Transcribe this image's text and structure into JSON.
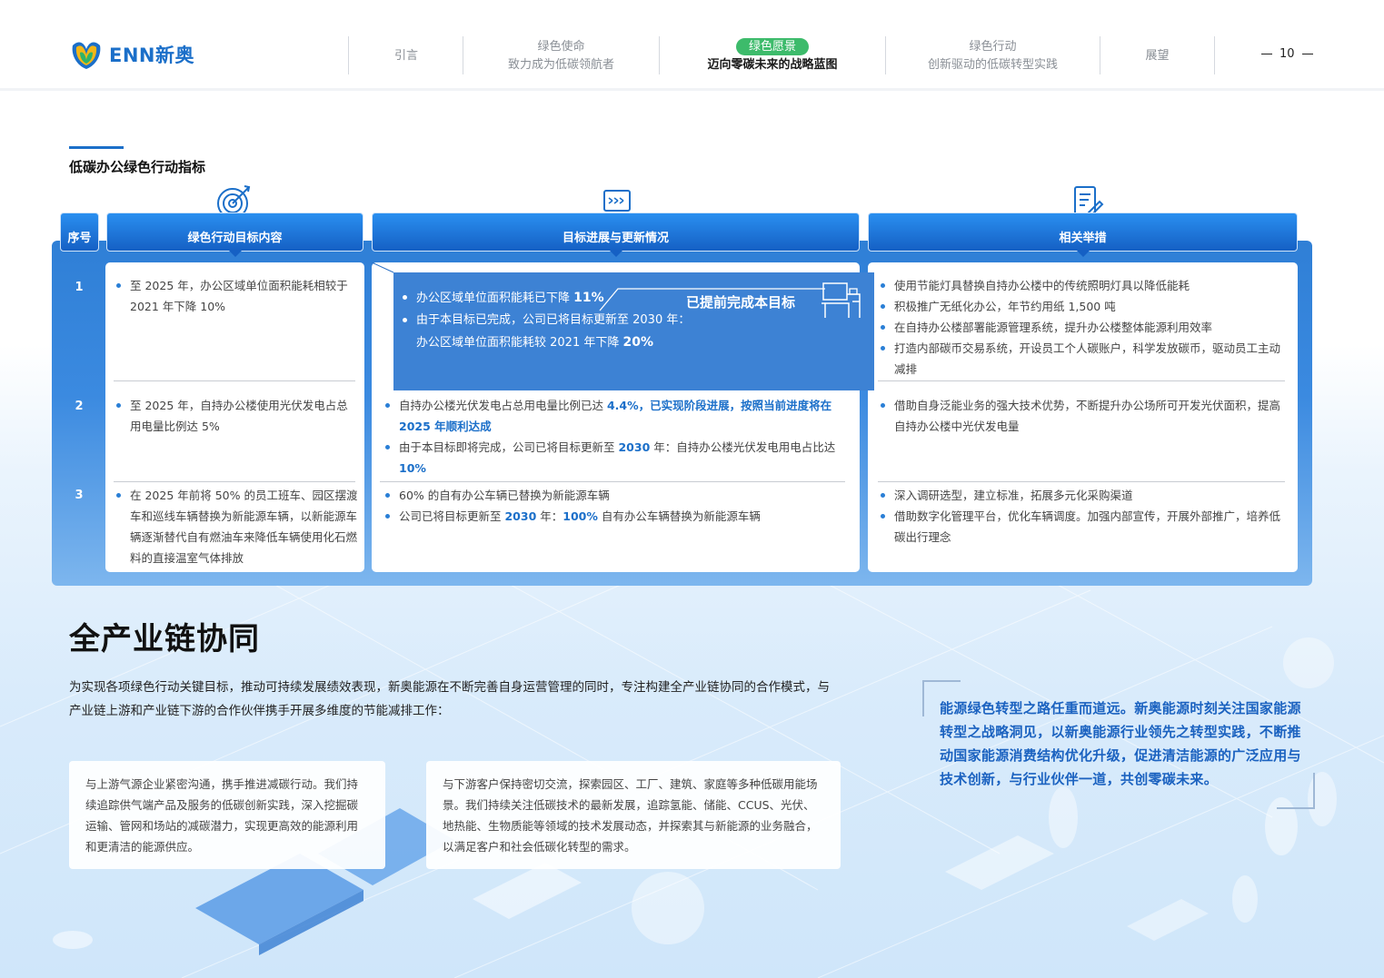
{
  "header": {
    "logo_text": "ENN新奥",
    "nav": [
      {
        "title": "引言",
        "sub": ""
      },
      {
        "title": "绿色使命",
        "sub": "致力成为低碳领航者"
      },
      {
        "title": "绿色愿景",
        "sub": "迈向零碳未来的战略蓝图",
        "active": true
      },
      {
        "title": "绿色行动",
        "sub": "创新驱动的低碳转型实践"
      },
      {
        "title": "展望",
        "sub": ""
      }
    ],
    "page_number": "10"
  },
  "section": {
    "title": "低碳办公绿色行动指标",
    "headers": {
      "seq": "序号",
      "target": "绿色行动目标内容",
      "progress": "目标进展与更新情况",
      "measures": "相关举措"
    },
    "rows": [
      {
        "seq": "1",
        "target": "至 2025 年，办公区域单位面积能耗相较于 2021 年下降 10%",
        "progress": {
          "p1_text": "办公区域单位面积能耗已下降 ",
          "p1_value": "11%",
          "p2_line1": "由于本目标已完成，公司已将目标更新至 2030 年：",
          "p2_line2_text": "办公区域单位面积能耗较 2021 年下降 ",
          "p2_line2_value": "20%",
          "badge": "已提前完成本目标"
        },
        "measures": [
          "使用节能灯具替换自持办公楼中的传统照明灯具以降低能耗",
          "积极推广无纸化办公，年节约用纸 1,500 吨",
          "在自持办公楼部署能源管理系统，提升办公楼整体能源利用效率",
          "打造内部碳币交易系统，开设员工个人碳账户，科学发放碳币，驱动员工主动减排"
        ]
      },
      {
        "seq": "2",
        "target": "至 2025 年，自持办公楼使用光伏发电占总用电量比例达 5%",
        "progress": {
          "p1_text": "自持办公楼光伏发电占总用电量比例已达 ",
          "p1_value": "4.4%，已实现阶段进展，按照当前进度将在 2025 年顺利达成",
          "p2_text": "由于本目标即将完成，公司已将目标更新至 ",
          "p2_year": "2030",
          "p2_mid": " 年：自持办公楼光伏发电用电占比达 ",
          "p2_value": "10%"
        },
        "measures": [
          "借助自身泛能业务的强大技术优势，不断提升办公场所可开发光伏面积，提高自持办公楼中光伏发电量"
        ]
      },
      {
        "seq": "3",
        "target": "在 2025 年前将 50% 的员工班车、园区摆渡车和巡线车辆替换为新能源车辆，以新能源车辆逐渐替代自有燃油车来降低车辆使用化石燃料的直接温室气体排放",
        "progress": {
          "p1_text": "60% 的自有办公车辆已替换为新能源车辆",
          "p2_text": "公司已将目标更新至 ",
          "p2_year": "2030",
          "p2_mid": " 年：",
          "p2_value": "100%",
          "p2_tail": " 自有办公车辆替换为新能源车辆"
        },
        "measures": [
          "深入调研选型，建立标准，拓展多元化采购渠道",
          "借助数字化管理平台，优化车辆调度。加强内部宣传，开展外部推广，培养低碳出行理念"
        ]
      }
    ]
  },
  "chain": {
    "title": "全产业链协同",
    "intro": "为实现各项绿色行动关键目标，推动可持续发展绩效表现，新奥能源在不断完善自身运营管理的同时，专注构建全产业链协同的合作模式，与产业链上游和产业链下游的合作伙伴携手开展多维度的节能减排工作：",
    "card_upstream": "与上游气源企业紧密沟通，携手推进减碳行动。我们持续追踪供气端产品及服务的低碳创新实践，深入挖掘碳运输、管网和场站的减碳潜力，实现更高效的能源利用和更清洁的能源供应。",
    "card_downstream": "与下游客户保持密切交流，探索园区、工厂、建筑、家庭等多种低碳用能场景。我们持续关注低碳技术的最新发展，追踪氢能、储能、CCUS、光伏、地热能、生物质能等领域的技术发展动态，并探索其与新能源的业务融合，以满足客户和社会低碳化转型的需求。",
    "quote": "能源绿色转型之路任重而道远。新奥能源时刻关注国家能源转型之战略洞见，以新奥能源行业领先之转型实践，不断推动国家能源消费结构优化升级，促进清洁能源的广泛应用与技术创新，与行业伙伴一道，共创零碳未来。"
  },
  "colors": {
    "brand_blue": "#1b6fc9",
    "active_green": "#3dbb6b",
    "table_blue": "#2f7fd6"
  }
}
